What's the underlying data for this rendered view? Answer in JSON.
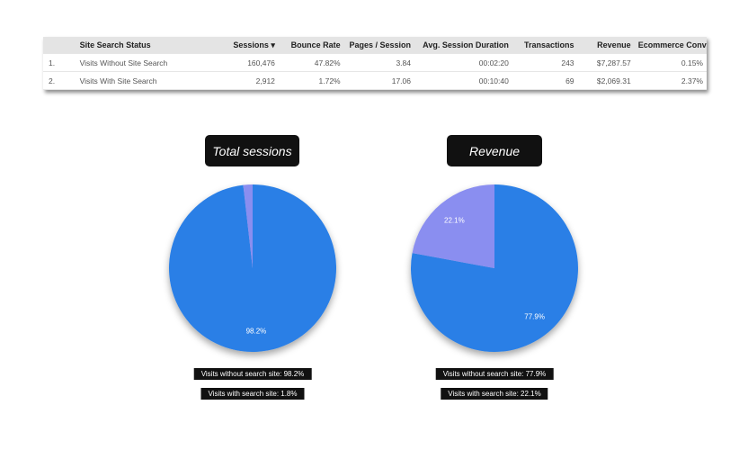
{
  "table": {
    "headers": [
      "",
      "Site Search Status",
      "Sessions ▾",
      "Bounce Rate",
      "Pages / Session",
      "Avg. Session Duration",
      "Transactions",
      "Revenue",
      "Ecommerce Conversi..."
    ],
    "rows": [
      [
        "1.",
        "Visits Without Site Search",
        "160,476",
        "47.82%",
        "3.84",
        "00:02:20",
        "243",
        "$7,287.57",
        "0.15%"
      ],
      [
        "2.",
        "Visits With Site Search",
        "2,912",
        "1.72%",
        "17.06",
        "00:10:40",
        "69",
        "$2,069.31",
        "2.37%"
      ]
    ]
  },
  "charts": [
    {
      "title": "Total sessions",
      "slices": [
        {
          "label": "98.2%",
          "value": 98.2,
          "color": "#2a7fe6"
        },
        {
          "label": "1.8%",
          "value": 1.8,
          "color": "#8a8ef0"
        }
      ],
      "legend": [
        "Visits without search site: 98.2%",
        "Visits with search site: 1.8%"
      ]
    },
    {
      "title": "Revenue",
      "slices": [
        {
          "label": "77.9%",
          "value": 77.9,
          "color": "#2a7fe6"
        },
        {
          "label": "22.1%",
          "value": 22.1,
          "color": "#8a8ef0"
        }
      ],
      "legend": [
        "Visits without search site: 77.9%",
        "Visits with search site: 22.1%"
      ]
    }
  ],
  "chart_data": [
    {
      "type": "pie",
      "title": "Total sessions",
      "categories": [
        "Visits without search site",
        "Visits with search site"
      ],
      "values": [
        98.2,
        1.8
      ]
    },
    {
      "type": "pie",
      "title": "Revenue",
      "categories": [
        "Visits without search site",
        "Visits with search site"
      ],
      "values": [
        77.9,
        22.1
      ]
    }
  ]
}
